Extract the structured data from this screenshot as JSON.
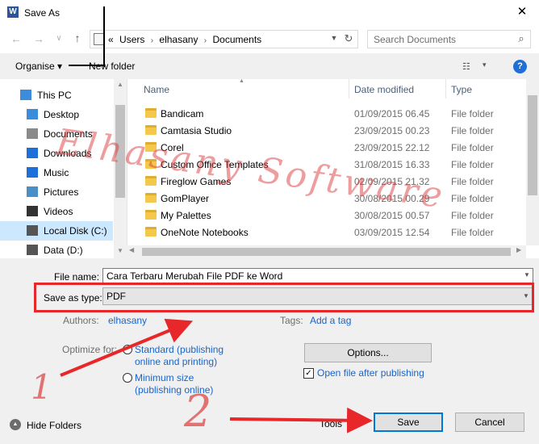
{
  "window": {
    "title": "Save As",
    "app_icon_letter": "W",
    "close_glyph": "✕"
  },
  "nav": {
    "back_glyph": "←",
    "forward_glyph": "→",
    "recent_glyph": "∨",
    "up_glyph": "↑",
    "breadcrumb_lead": "«",
    "breadcrumbs": [
      "Users",
      "elhasany",
      "Documents"
    ],
    "crumb_separator": "›",
    "refresh_glyph": "↻",
    "search_placeholder": "Search Documents",
    "search_glyph": "⌕"
  },
  "toolbar": {
    "organise_label": "Organise ▾",
    "new_folder_label": "New folder",
    "view_glyph": "☷",
    "view_dd_glyph": "▾",
    "help_glyph": "?"
  },
  "sidebar": {
    "items": [
      {
        "label": "This PC",
        "icon": "computer-icon",
        "color": "#3c8cdc"
      },
      {
        "label": "Desktop",
        "icon": "desktop-icon",
        "color": "#3c8cdc"
      },
      {
        "label": "Documents",
        "icon": "documents-icon",
        "color": "#8a8a8a"
      },
      {
        "label": "Downloads",
        "icon": "downloads-icon",
        "color": "#1e6fd9"
      },
      {
        "label": "Music",
        "icon": "music-icon",
        "color": "#1e6fd9"
      },
      {
        "label": "Pictures",
        "icon": "pictures-icon",
        "color": "#4a90c8"
      },
      {
        "label": "Videos",
        "icon": "videos-icon",
        "color": "#333333"
      },
      {
        "label": "Local Disk (C:)",
        "icon": "drive-icon",
        "color": "#555555"
      },
      {
        "label": "Data (D:)",
        "icon": "drive-icon",
        "color": "#555555"
      }
    ],
    "selected_index": 7
  },
  "filelist": {
    "columns": [
      "Name",
      "Date modified",
      "Type"
    ],
    "rows": [
      {
        "name": "Bandicam",
        "date": "01/09/2015 06.45",
        "type": "File folder"
      },
      {
        "name": "Camtasia Studio",
        "date": "23/09/2015 00.23",
        "type": "File folder"
      },
      {
        "name": "Corel",
        "date": "23/09/2015 22.12",
        "type": "File folder"
      },
      {
        "name": "Custom Office Templates",
        "date": "31/08/2015 16.33",
        "type": "File folder"
      },
      {
        "name": "Fireglow Games",
        "date": "02/09/2015 21.32",
        "type": "File folder"
      },
      {
        "name": "GomPlayer",
        "date": "30/08/2015 00.29",
        "type": "File folder"
      },
      {
        "name": "My Palettes",
        "date": "30/08/2015 00.57",
        "type": "File folder"
      },
      {
        "name": "OneNote Notebooks",
        "date": "03/09/2015 12.54",
        "type": "File folder"
      }
    ]
  },
  "form": {
    "file_name_label": "File name:",
    "file_name_value": "Cara Terbaru Merubah File PDF ke Word",
    "save_as_type_label": "Save as type:",
    "save_as_type_value": "PDF",
    "authors_label": "Authors:",
    "authors_value": "elhasany",
    "tags_label": "Tags:",
    "tags_value": "Add a tag",
    "optimize_label": "Optimize for:",
    "standard_label_1": "Standard (publishing",
    "standard_label_2": "online and printing)",
    "minimum_label_1": "Minimum size",
    "minimum_label_2": "(publishing online)",
    "options_button": "Options...",
    "open_after_label": "Open file after publishing",
    "open_after_checked": "✓",
    "hide_folders_label": "Hide Folders",
    "hide_glyph": "▲",
    "tools_label": "Tools",
    "save_button": "Save",
    "cancel_button": "Cancel"
  },
  "overlay": {
    "watermark": "Elhasany Software",
    "step1": "1",
    "step2": "2",
    "accent_color": "#e8272a"
  }
}
